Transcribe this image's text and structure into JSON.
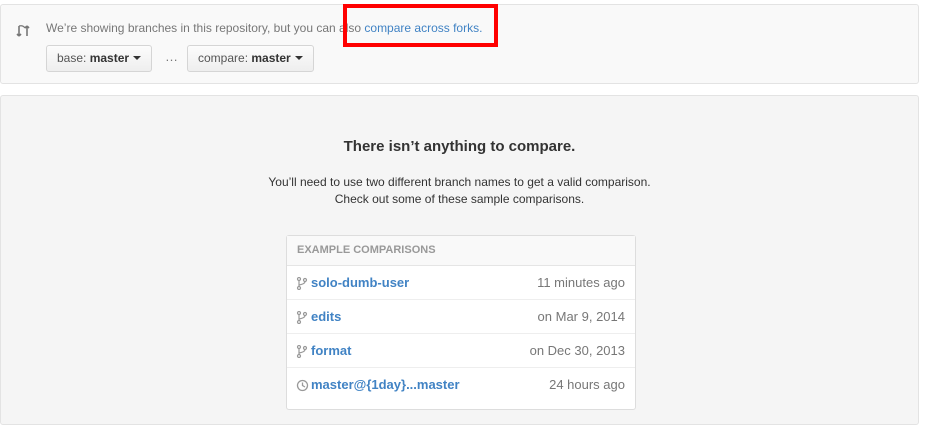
{
  "range_editor": {
    "notice_text": "We’re showing branches in this repository, but you can also ",
    "compare_forks_link": "compare across forks.",
    "base_prefix": "base: ",
    "base_branch": "master",
    "separator": "…",
    "compare_prefix": "compare: ",
    "compare_branch": "master"
  },
  "blankslate": {
    "title": "There isn’t anything to compare.",
    "line1": "You’ll need to use two different branch names to get a valid comparison.",
    "line2": "Check out some of these sample comparisons."
  },
  "examples": {
    "header": "EXAMPLE COMPARISONS",
    "rows": [
      {
        "name": "solo-dumb-user",
        "date": "11 minutes ago",
        "icon": "branch-icon"
      },
      {
        "name": "edits",
        "date": "on Mar 9, 2014",
        "icon": "branch-icon"
      },
      {
        "name": "format",
        "date": "on Dec 30, 2013",
        "icon": "branch-icon"
      },
      {
        "name": "master@{1day}...master",
        "date": "24 hours ago",
        "icon": "history-icon"
      }
    ]
  },
  "colors": {
    "link": "#4183c4",
    "highlight": "#ff0000"
  }
}
